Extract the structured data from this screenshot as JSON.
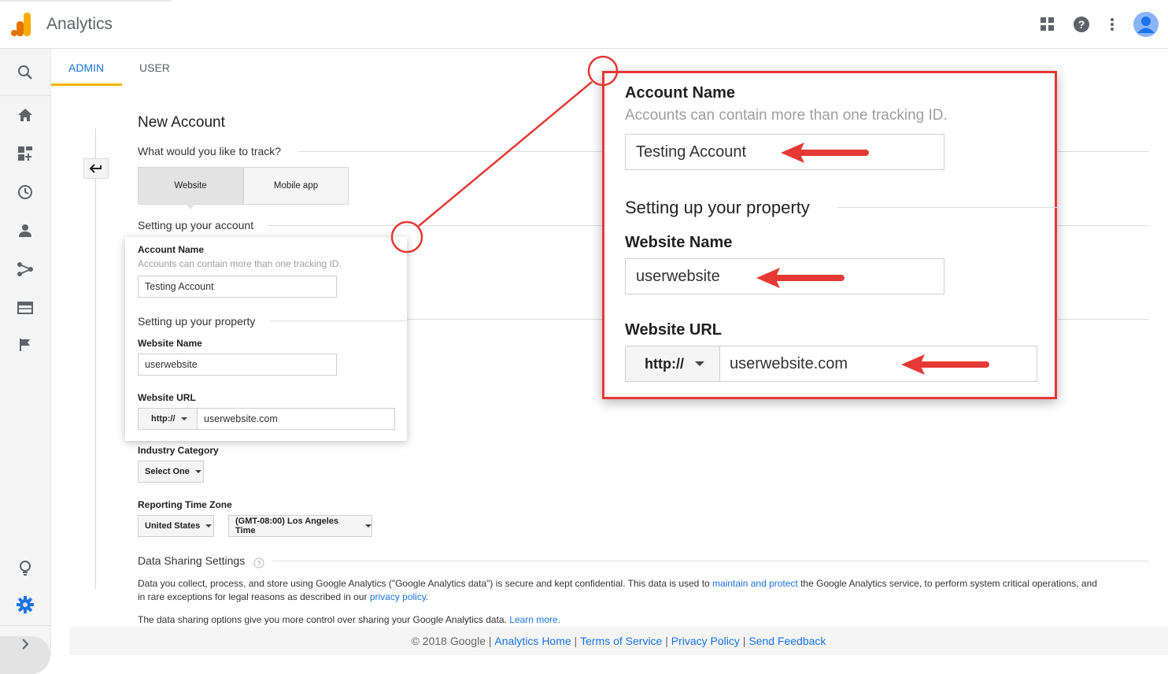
{
  "app": {
    "title": "Analytics",
    "colors": {
      "accent": "#1a73e8",
      "callout": "#e53935",
      "logo_orange": "#f9ab00",
      "logo_dark": "#e37400"
    }
  },
  "topbar": {
    "icons": [
      "apps-grid-icon",
      "help-icon",
      "more-vert-icon",
      "account-avatar-icon"
    ]
  },
  "rail": {
    "icons": [
      "search-icon",
      "home-icon",
      "customization-icon",
      "realtime-clock-icon",
      "audience-person-icon",
      "acquisition-icon",
      "behavior-icon",
      "conversions-flag-icon",
      "discover-lightbulb-icon",
      "admin-gear-icon",
      "expand-chevron-icon"
    ]
  },
  "tabs": {
    "admin": "ADMIN",
    "user": "USER"
  },
  "form": {
    "heading": "New Account",
    "track_question": "What would you like to track?",
    "options": {
      "website": "Website",
      "mobile": "Mobile app"
    },
    "account_section": "Setting up your account",
    "account_name_label": "Account Name",
    "account_name_help": "Accounts can contain more than one tracking ID.",
    "account_name_value": "Testing Account",
    "property_section": "Setting up your property",
    "website_name_label": "Website Name",
    "website_name_value": "userwebsite",
    "website_url_label": "Website URL",
    "protocol": "http://",
    "website_url_value": "userwebsite.com",
    "industry_label": "Industry Category",
    "industry_value": "Select One",
    "timezone_label": "Reporting Time Zone",
    "country_value": "United States",
    "timezone_value": "(GMT-08:00) Los Angeles Time",
    "data_sharing_title": "Data Sharing Settings",
    "data_sharing_p1_a": "Data you collect, process, and store using Google Analytics (\"Google Analytics data\") is secure and kept confidential. This data is used to ",
    "data_sharing_p1_link": "maintain and protect",
    "data_sharing_p1_b": " the Google Analytics service, to perform system critical operations, and",
    "data_sharing_p1_c": "in rare exceptions for legal reasons as described in our ",
    "data_sharing_p1_link2": "privacy policy.",
    "data_sharing_p2": "The data sharing options give you more control over sharing your Google Analytics data. ",
    "data_sharing_p2_link": "Learn more."
  },
  "footer": {
    "copyright": "© 2018 Google",
    "links": [
      "Analytics Home",
      "Terms of Service",
      "Privacy Policy",
      "Send Feedback"
    ]
  }
}
